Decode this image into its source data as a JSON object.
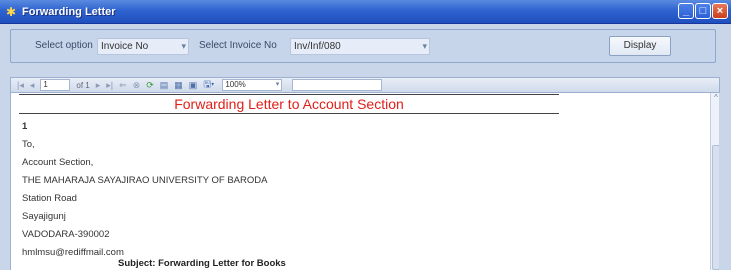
{
  "window": {
    "title": "Forwarding Letter",
    "min_symbol": "_",
    "max_symbol": "□",
    "close_symbol": "×"
  },
  "options": {
    "select_option_label": "Select option",
    "select_option_value": "Invoice No",
    "select_invoice_label": "Select Invoice No",
    "select_invoice_value": "Inv/Inf/080",
    "display_button": "Display"
  },
  "toolbar": {
    "page": "1",
    "of_label": "of 1",
    "zoom": "100%"
  },
  "report": {
    "title": "Forwarding Letter to Account Section",
    "lines": [
      "1",
      "To,",
      "Account Section,",
      "THE MAHARAJA SAYAJIRAO UNIVERSITY OF BARODA",
      "Station Road",
      "Sayajigunj",
      "VADODARA-390002",
      "hmlmsu@rediffmail.com"
    ],
    "subject": "Subject:  Forwarding Letter for Books"
  }
}
